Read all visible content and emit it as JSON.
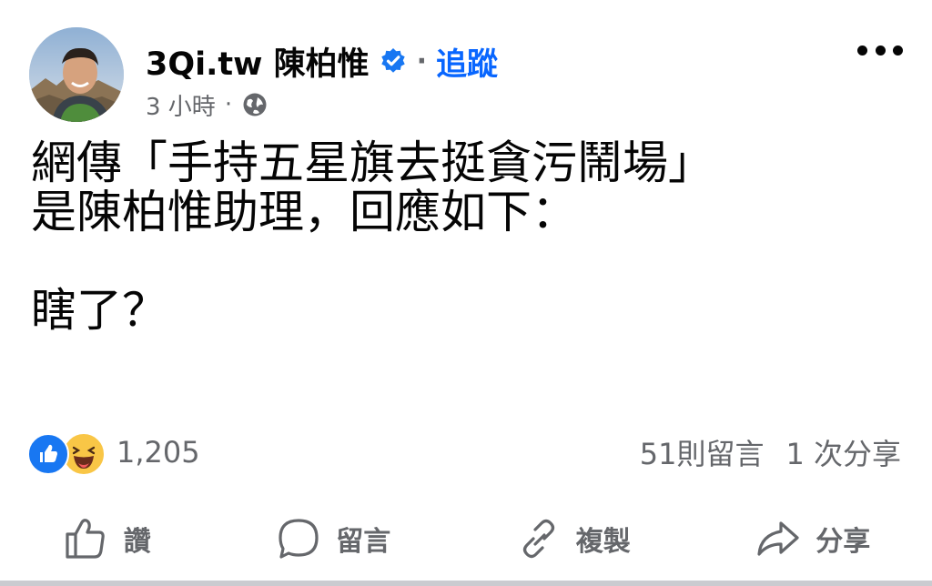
{
  "post": {
    "author": {
      "name": "3Qi.tw 陳柏惟",
      "verified": true,
      "follow_label": "追蹤",
      "separator": "·"
    },
    "meta": {
      "time": "3 小時",
      "separator": "·",
      "audience_icon": "globe-icon"
    },
    "more_icon": "more-options-icon",
    "text": "網傳「手持五星旗去挺貪污鬧場」\n是陳柏惟助理，回應如下：\n\n瞎了？"
  },
  "stats": {
    "reaction_icons": [
      "like-icon",
      "haha-icon"
    ],
    "reaction_count": "1,205",
    "comments": "51則留言",
    "shares": "1 次分享"
  },
  "actions": {
    "like": "讚",
    "comment": "留言",
    "copy": "複製",
    "share": "分享"
  },
  "colors": {
    "primary_text": "#050505",
    "secondary_text": "#65676b",
    "accent_blue": "#0866ff",
    "like_blue": "#1877f2",
    "haha_yellow": "#f9c646"
  }
}
